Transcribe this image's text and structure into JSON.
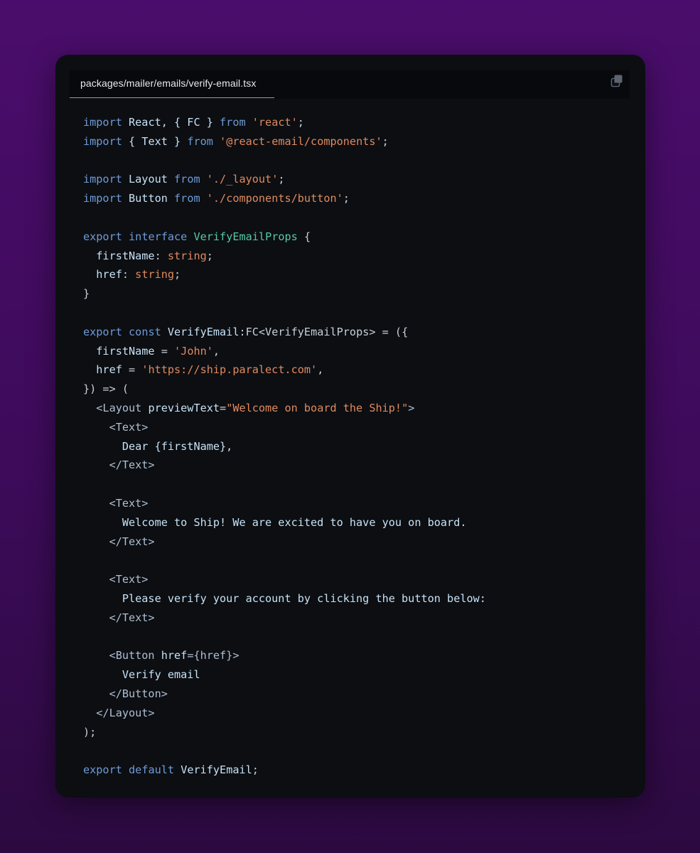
{
  "file_tab": {
    "label": "packages/mailer/emails/verify-email.tsx"
  },
  "toolbar": {
    "copy_icon": "copy-icon"
  },
  "colors": {
    "background_top": "#4a0d6b",
    "background_bottom": "#2c0a40",
    "card": "#0c0e12",
    "keyword": "#6e9bd6",
    "string": "#e08a5e",
    "type_name": "#56c9a3",
    "identifier": "#c6e2f5"
  },
  "code": {
    "lines": [
      [
        {
          "t": "import",
          "c": "kw"
        },
        {
          "t": " React, { FC } ",
          "c": "id"
        },
        {
          "t": "from",
          "c": "kw"
        },
        {
          "t": " ",
          "c": "pl"
        },
        {
          "t": "'react'",
          "c": "str"
        },
        {
          "t": ";",
          "c": "pl"
        }
      ],
      [
        {
          "t": "import",
          "c": "kw"
        },
        {
          "t": " { Text } ",
          "c": "id"
        },
        {
          "t": "from",
          "c": "kw"
        },
        {
          "t": " ",
          "c": "pl"
        },
        {
          "t": "'@react-email/components'",
          "c": "str"
        },
        {
          "t": ";",
          "c": "pl"
        }
      ],
      [],
      [
        {
          "t": "import",
          "c": "kw"
        },
        {
          "t": " Layout ",
          "c": "id"
        },
        {
          "t": "from",
          "c": "kw"
        },
        {
          "t": " ",
          "c": "pl"
        },
        {
          "t": "'./_layout'",
          "c": "str"
        },
        {
          "t": ";",
          "c": "pl"
        }
      ],
      [
        {
          "t": "import",
          "c": "kw"
        },
        {
          "t": " Button ",
          "c": "id"
        },
        {
          "t": "from",
          "c": "kw"
        },
        {
          "t": " ",
          "c": "pl"
        },
        {
          "t": "'./components/button'",
          "c": "str"
        },
        {
          "t": ";",
          "c": "pl"
        }
      ],
      [],
      [
        {
          "t": "export",
          "c": "kw"
        },
        {
          "t": " ",
          "c": "pl"
        },
        {
          "t": "interface",
          "c": "kw"
        },
        {
          "t": " ",
          "c": "pl"
        },
        {
          "t": "VerifyEmailProps",
          "c": "type"
        },
        {
          "t": " {",
          "c": "pl"
        }
      ],
      [
        {
          "t": "  firstName",
          "c": "id"
        },
        {
          "t": ": ",
          "c": "pl"
        },
        {
          "t": "string",
          "c": "str"
        },
        {
          "t": ";",
          "c": "pl"
        }
      ],
      [
        {
          "t": "  href",
          "c": "id"
        },
        {
          "t": ": ",
          "c": "pl"
        },
        {
          "t": "string",
          "c": "str"
        },
        {
          "t": ";",
          "c": "pl"
        }
      ],
      [
        {
          "t": "}",
          "c": "pl"
        }
      ],
      [],
      [
        {
          "t": "export",
          "c": "kw"
        },
        {
          "t": " ",
          "c": "pl"
        },
        {
          "t": "const",
          "c": "kw"
        },
        {
          "t": " VerifyEmail",
          "c": "id"
        },
        {
          "t": ":FC<VerifyEmailProps> = ({",
          "c": "pl"
        }
      ],
      [
        {
          "t": "  firstName",
          "c": "id"
        },
        {
          "t": " = ",
          "c": "pl"
        },
        {
          "t": "'John'",
          "c": "str"
        },
        {
          "t": ",",
          "c": "pl"
        }
      ],
      [
        {
          "t": "  href",
          "c": "id"
        },
        {
          "t": " = ",
          "c": "pl"
        },
        {
          "t": "'https://ship.paralect.com'",
          "c": "str"
        },
        {
          "t": ",",
          "c": "pl"
        }
      ],
      [
        {
          "t": "}) => (",
          "c": "pl"
        }
      ],
      [
        {
          "t": "  <Layout ",
          "c": "tag"
        },
        {
          "t": "previewText",
          "c": "id"
        },
        {
          "t": "=",
          "c": "pl"
        },
        {
          "t": "\"Welcome on board the Ship!\"",
          "c": "str"
        },
        {
          "t": ">",
          "c": "tag"
        }
      ],
      [
        {
          "t": "    <Text>",
          "c": "tag"
        }
      ],
      [
        {
          "t": "      Dear {firstName},",
          "c": "id"
        }
      ],
      [
        {
          "t": "    </Text>",
          "c": "tag"
        }
      ],
      [],
      [
        {
          "t": "    <Text>",
          "c": "tag"
        }
      ],
      [
        {
          "t": "      Welcome to Ship! We are excited to have you on board.",
          "c": "id"
        }
      ],
      [
        {
          "t": "    </Text>",
          "c": "tag"
        }
      ],
      [],
      [
        {
          "t": "    <Text>",
          "c": "tag"
        }
      ],
      [
        {
          "t": "      Please verify your account by clicking the button below:",
          "c": "id"
        }
      ],
      [
        {
          "t": "    </Text>",
          "c": "tag"
        }
      ],
      [],
      [
        {
          "t": "    <Button ",
          "c": "tag"
        },
        {
          "t": "href",
          "c": "id"
        },
        {
          "t": "={href}>",
          "c": "tag"
        }
      ],
      [
        {
          "t": "      Verify email",
          "c": "id"
        }
      ],
      [
        {
          "t": "    </Button>",
          "c": "tag"
        }
      ],
      [
        {
          "t": "  </Layout>",
          "c": "tag"
        }
      ],
      [
        {
          "t": ");",
          "c": "pl"
        }
      ],
      [],
      [
        {
          "t": "export",
          "c": "kw"
        },
        {
          "t": " ",
          "c": "pl"
        },
        {
          "t": "default",
          "c": "kw"
        },
        {
          "t": " VerifyEmail",
          "c": "id"
        },
        {
          "t": ";",
          "c": "pl"
        }
      ]
    ]
  }
}
